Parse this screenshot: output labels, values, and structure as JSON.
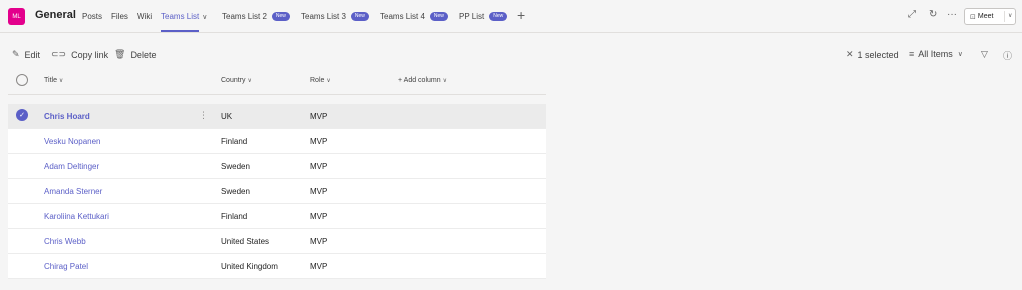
{
  "team": {
    "initials": "ML",
    "channel": "General"
  },
  "tabs": [
    {
      "label": "Posts"
    },
    {
      "label": "Files"
    },
    {
      "label": "Wiki"
    },
    {
      "label": "Teams List",
      "active": true,
      "chevron": "∨"
    },
    {
      "label": "Teams List 2",
      "badge": "New"
    },
    {
      "label": "Teams List 3",
      "badge": "New"
    },
    {
      "label": "Teams List 4",
      "badge": "New"
    },
    {
      "label": "PP List",
      "badge": "New"
    }
  ],
  "add_tab_label": "+",
  "header_icons": {
    "expand": "expand-icon",
    "refresh": "refresh-icon",
    "more": "more-icon"
  },
  "meet": {
    "label": "Meet"
  },
  "commands": {
    "edit": "Edit",
    "copy_link": "Copy link",
    "delete": "Delete",
    "selected": "1 selected",
    "view": "All Items"
  },
  "columns": {
    "title": "Title",
    "country": "Country",
    "role": "Role",
    "add": "+ Add column"
  },
  "rows": [
    {
      "name": "Chris Hoard",
      "country": "UK",
      "role": "MVP",
      "selected": true
    },
    {
      "name": "Vesku Nopanen",
      "country": "Finland",
      "role": "MVP"
    },
    {
      "name": "Adam Deltinger",
      "country": "Sweden",
      "role": "MVP"
    },
    {
      "name": "Amanda Sterner",
      "country": "Sweden",
      "role": "MVP"
    },
    {
      "name": "Karoliina Kettukari",
      "country": "Finland",
      "role": "MVP"
    },
    {
      "name": "Chris Webb",
      "country": "United States",
      "role": "MVP"
    },
    {
      "name": "Chirag Patel",
      "country": "United Kingdom",
      "role": "MVP"
    }
  ],
  "colors": {
    "accent": "#5b5fc7",
    "avatar": "#e3008c"
  }
}
